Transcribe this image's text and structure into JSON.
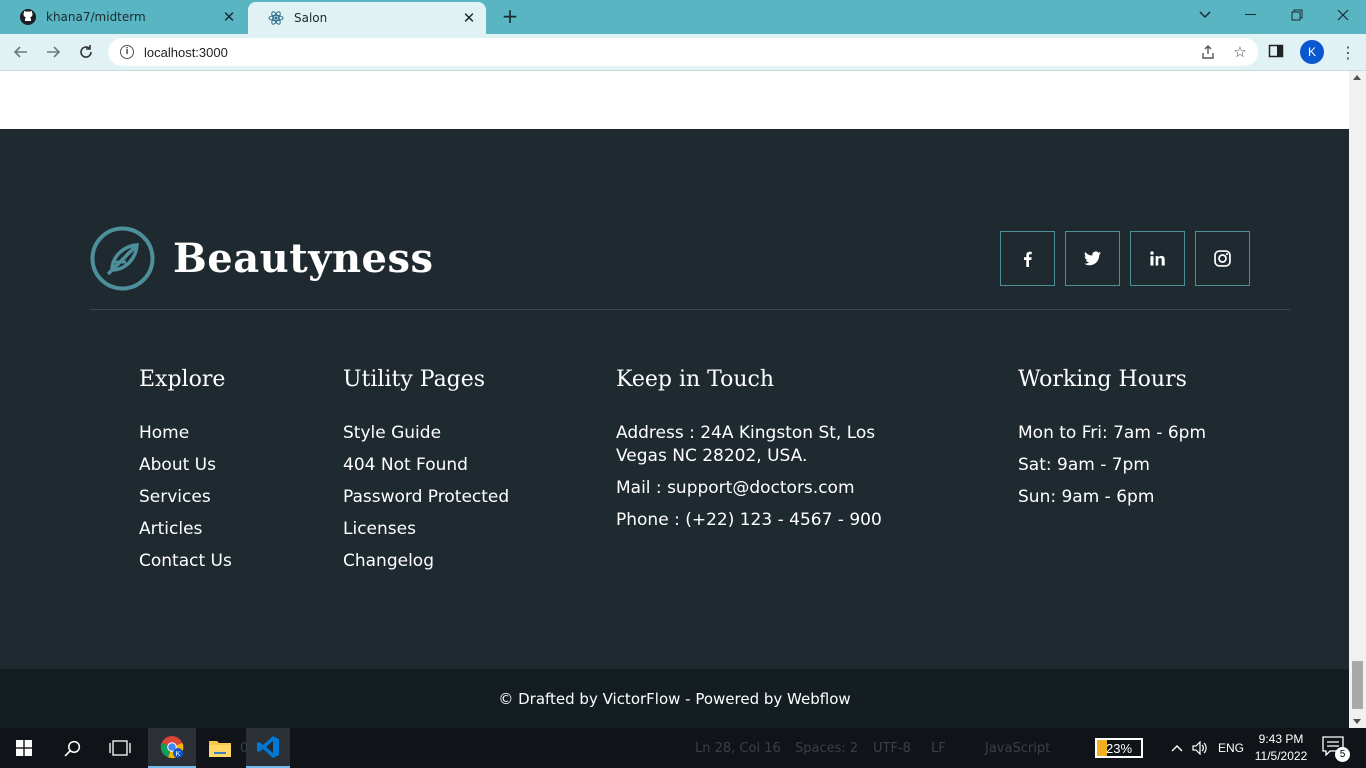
{
  "browser": {
    "tabs": [
      {
        "title": "khana7/midterm",
        "favicon": "github-icon"
      },
      {
        "title": "Salon",
        "favicon": "react-icon",
        "active": true
      }
    ],
    "url": "localhost:3000",
    "profile_initial": "K"
  },
  "footer": {
    "brand_name": "Beautyness",
    "socials": [
      "facebook-icon",
      "twitter-icon",
      "linkedin-icon",
      "instagram-icon"
    ],
    "explore": {
      "heading": "Explore",
      "links": [
        "Home",
        "About Us",
        "Services",
        "Articles",
        "Contact Us"
      ]
    },
    "utility": {
      "heading": "Utility Pages",
      "links": [
        "Style Guide",
        "404 Not Found",
        "Password Protected",
        "Licenses",
        "Changelog"
      ]
    },
    "contact": {
      "heading": "Keep in Touch",
      "address": "Address : 24A Kingston St, Los Vegas NC 28202, USA.",
      "mail": "Mail : support@doctors.com",
      "phone": "Phone : (+22) 123 - 4567 - 900"
    },
    "hours": {
      "heading": "Working Hours",
      "lines": [
        "Mon to Fri: 7am - 6pm",
        "Sat: 9am - 7pm",
        "Sun: 9am - 6pm"
      ]
    },
    "copyright": "© Drafted by VictorFlow - Powered by Webflow"
  },
  "taskbar": {
    "status": {
      "position": "Ln 28, Col 16",
      "spaces": "Spaces: 2",
      "encoding": "UTF-8",
      "eol": "LF",
      "language": "JavaScript",
      "count": "0"
    },
    "battery_percent": 23,
    "battery_label": "23%",
    "language": "ENG",
    "time": "9:43 PM",
    "date": "11/5/2022",
    "notifications": "5"
  },
  "colors": {
    "footer_bg": "#1f2a30",
    "footer_bottom_bg": "#141d22",
    "accent_teal": "#4d8f9a",
    "chrome_tab_bar": "#5ab5c3"
  }
}
